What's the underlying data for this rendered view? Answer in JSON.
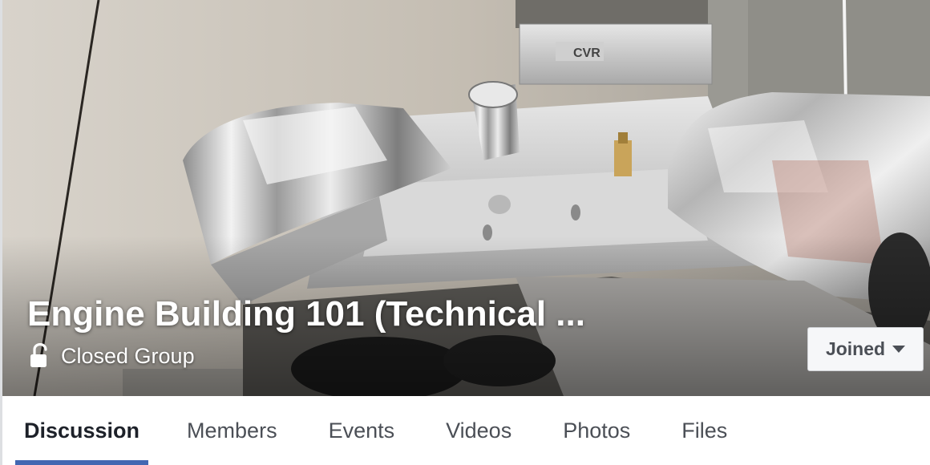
{
  "group": {
    "name": "Engine Building 101 (Technical ...",
    "privacy_label": "Closed Group",
    "privacy_icon": "unlocked-padlock-icon",
    "joined_label": "Joined",
    "joined_caret_icon": "caret-down-icon"
  },
  "tabs": [
    {
      "label": "Discussion",
      "active": true
    },
    {
      "label": "Members",
      "active": false
    },
    {
      "label": "Events",
      "active": false
    },
    {
      "label": "Videos",
      "active": false
    },
    {
      "label": "Photos",
      "active": false
    },
    {
      "label": "Files",
      "active": false
    }
  ],
  "colors": {
    "active_tab_underline": "#4267b2",
    "active_tab_text": "#1d2129",
    "tab_text": "#4b4f56",
    "button_background": "#f6f7f9",
    "button_border": "#ced0d4"
  }
}
